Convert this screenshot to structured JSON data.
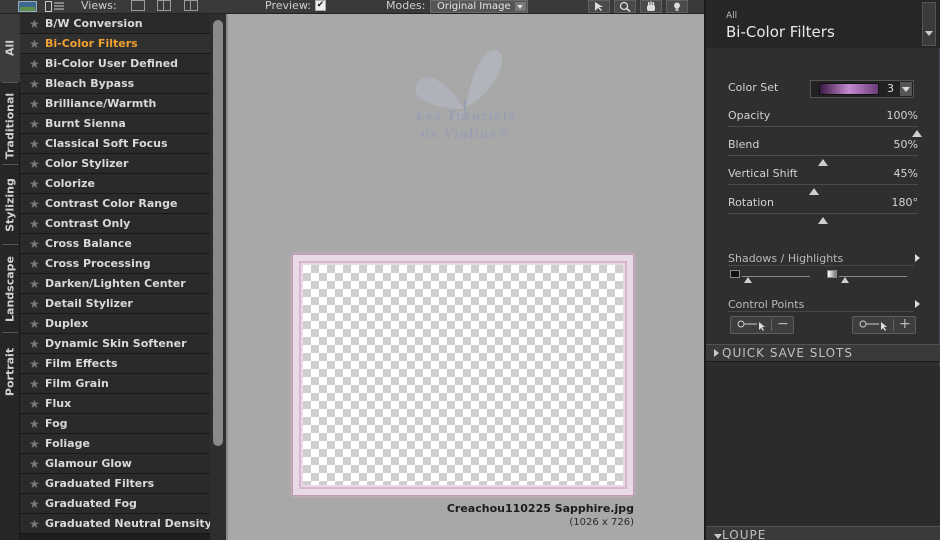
{
  "toolbar": {
    "views_label": "Views:",
    "preview_label": "Preview:",
    "preview_checked": "✔",
    "modes_label": "Modes:",
    "modes_value": "Original Image"
  },
  "vtabs": [
    "All",
    "Traditional",
    "Stylizing",
    "Landscape",
    "Portrait"
  ],
  "filters": [
    "B/W Conversion",
    "Bi-Color Filters",
    "Bi-Color User Defined",
    "Bleach Bypass",
    "Brilliance/Warmth",
    "Burnt Sienna",
    "Classical Soft Focus",
    "Color Stylizer",
    "Colorize",
    "Contrast Color Range",
    "Contrast Only",
    "Cross Balance",
    "Cross Processing",
    "Darken/Lighten Center",
    "Detail Stylizer",
    "Duplex",
    "Dynamic Skin Softener",
    "Film Effects",
    "Film Grain",
    "Flux",
    "Fog",
    "Foliage",
    "Glamour Glow",
    "Graduated Filters",
    "Graduated Fog",
    "Graduated Neutral Density"
  ],
  "active_filter_index": 1,
  "preview": {
    "watermark_line1": "Les Tutoriels",
    "watermark_line2": "de Violine©",
    "image_name": "Creachou110225 Sapphire.jpg",
    "image_size": "(1026 x 726)"
  },
  "panel": {
    "category": "All",
    "filter_name": "Bi-Color Filters",
    "color_set_label": "Color Set",
    "color_set_value": "3",
    "sliders": [
      {
        "label": "Opacity",
        "value": "100%",
        "level": 1.0
      },
      {
        "label": "Blend",
        "value": "50%",
        "level": 0.5
      },
      {
        "label": "Vertical Shift",
        "value": "45%",
        "level": 0.45
      },
      {
        "label": "Rotation",
        "value": "180°",
        "level": 0.5
      }
    ],
    "shadows_highlights": "Shadows / Highlights",
    "control_points": "Control Points",
    "minus": "−",
    "plus": "+",
    "quick_save": "QUICK SAVE SLOTS",
    "loupe": "LOUPE"
  }
}
